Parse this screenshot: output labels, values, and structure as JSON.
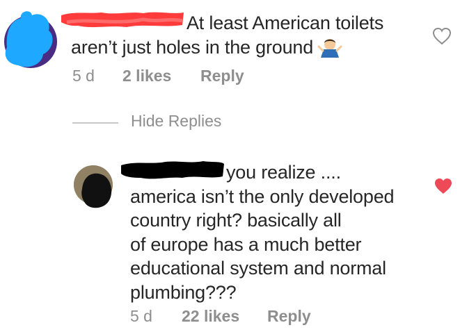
{
  "comment": {
    "text_line1": "At least American toilets",
    "text_line2": "aren’t just holes in the ground",
    "time": "5 d",
    "likes": "2 likes",
    "reply": "Reply",
    "liked": false
  },
  "thread": {
    "hide_replies": "Hide Replies"
  },
  "reply": {
    "lines": [
      "you realize ....",
      "america isn’t the only developed",
      "country right? basically all",
      "of europe has a much better",
      "educational system and normal",
      "plumbing???"
    ],
    "time": "5 d",
    "likes": "22 likes",
    "reply": "Reply",
    "liked": true
  },
  "colors": {
    "like_active": "#ed4956",
    "muted": "#8e8e8e",
    "redaction_red": "#ff3b3b",
    "redaction_black": "#000000",
    "avatar_blue": "#1ea8ff"
  },
  "icons": {
    "shrug": "man-shrugging-emoji",
    "heart_outline": "heart-outline-icon",
    "heart_filled": "heart-filled-icon"
  }
}
